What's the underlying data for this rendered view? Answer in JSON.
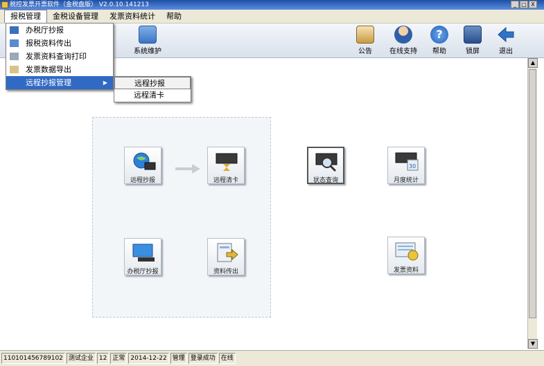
{
  "window": {
    "title": "税控发票开票软件（金税盘版） V2.0.10.141213",
    "min": "_",
    "max": "□",
    "close": "X"
  },
  "menubar": [
    "报税管理",
    "金税设备管理",
    "发票资料统计",
    "帮助"
  ],
  "toolbar": {
    "system_maintain": "系统维护",
    "notice": "公告",
    "online_support": "在线支持",
    "help": "帮助",
    "lock": "锁屏",
    "exit": "退出"
  },
  "dropdown": {
    "items": [
      "办税厅抄报",
      "报税资料传出",
      "发票资料查询打印",
      "发票数据导出",
      "远程抄报管理"
    ],
    "submenu_arrow": "▶"
  },
  "submenu": {
    "items": [
      "远程抄报",
      "远程清卡"
    ]
  },
  "tiles": {
    "remote_copy": "远程抄报",
    "remote_clear": "远程清卡",
    "hall_copy": "办税厅抄报",
    "data_export": "资料传出",
    "status_query": "状态查询",
    "monthly_stats": "月度统计",
    "invoice_data": "发票资料"
  },
  "statusbar": [
    "110101456789102",
    "测试企业",
    "12",
    "正常",
    "2014-12-22",
    "管理",
    "登录成功",
    "在线"
  ],
  "colors": {
    "title_bar": "#1e4fa6",
    "menu_bg": "#ece9d8",
    "highlight": "#316ac5"
  }
}
